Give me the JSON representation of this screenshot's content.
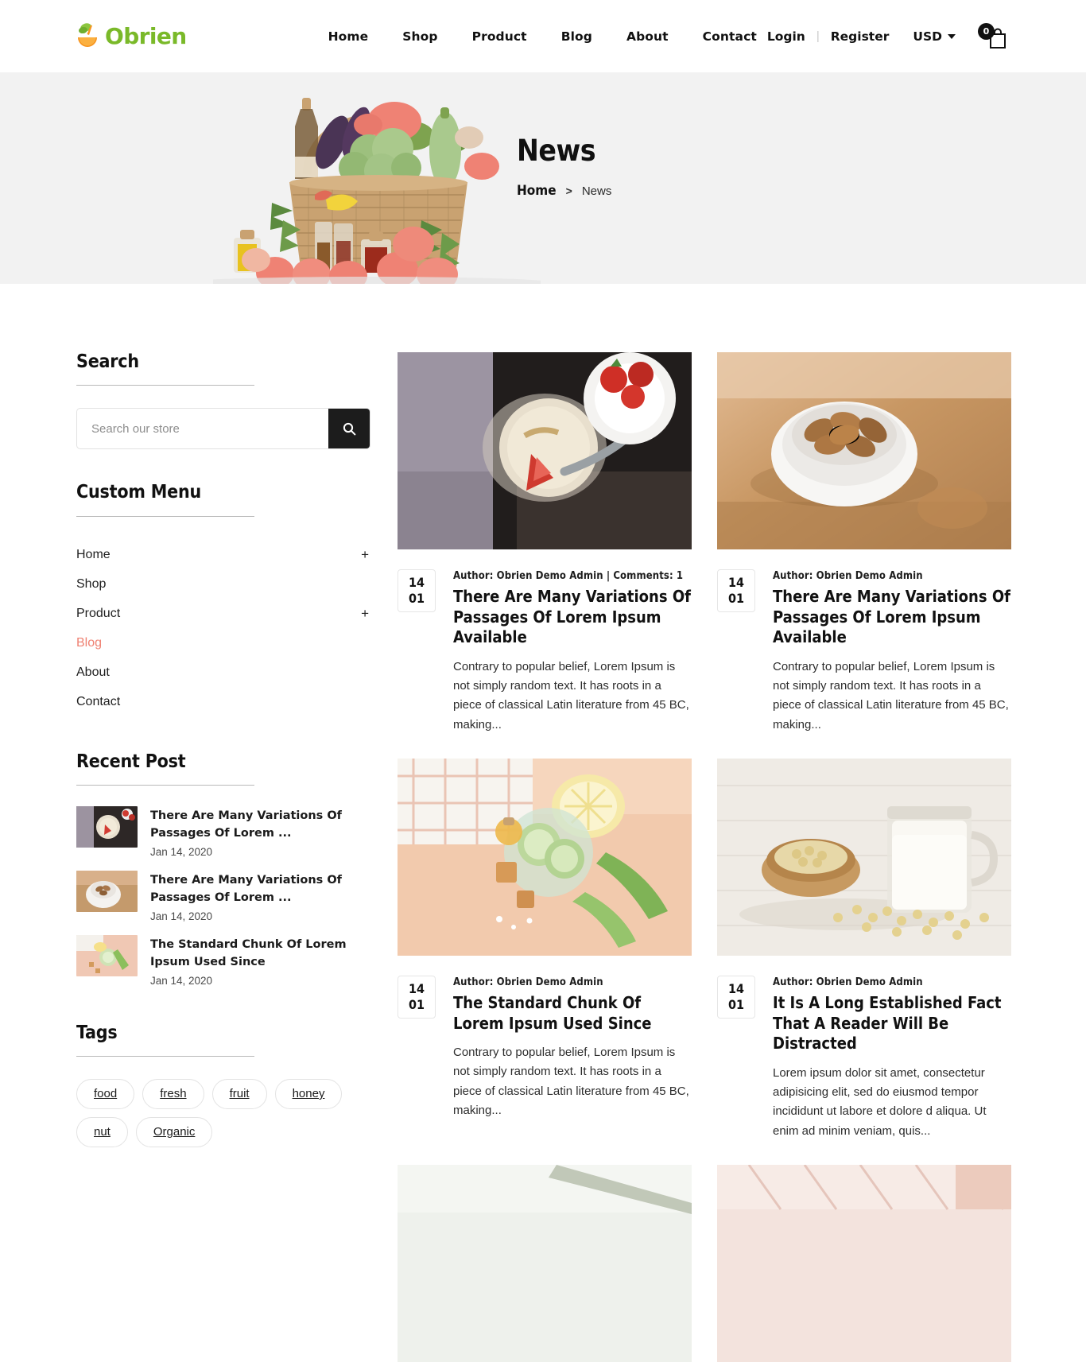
{
  "header": {
    "brand": "Obrien",
    "nav": [
      {
        "label": "Home"
      },
      {
        "label": "Shop"
      },
      {
        "label": "Product"
      },
      {
        "label": "Blog"
      },
      {
        "label": "About"
      },
      {
        "label": "Contact"
      }
    ],
    "login": "Login",
    "separator": "|",
    "register": "Register",
    "currency": "USD",
    "cart_count": "0",
    "brand_color": "#7ab929"
  },
  "hero": {
    "title": "News",
    "breadcrumb_home": "Home",
    "breadcrumb_sep": ">",
    "breadcrumb_current": "News",
    "background": "#f2f2f2"
  },
  "sidebar": {
    "search": {
      "title": "Search",
      "placeholder": "Search our store",
      "value": "",
      "button_icon": "search-icon"
    },
    "custom_menu": {
      "title": "Custom Menu",
      "items": [
        {
          "label": "Home",
          "expand": "+",
          "active": false
        },
        {
          "label": "Shop",
          "expand": "",
          "active": false
        },
        {
          "label": "Product",
          "expand": "+",
          "active": false
        },
        {
          "label": "Blog",
          "expand": "",
          "active": true
        },
        {
          "label": "About",
          "expand": "",
          "active": false
        },
        {
          "label": "Contact",
          "expand": "",
          "active": false
        }
      ],
      "active_color": "#ef8172"
    },
    "recent_post": {
      "title": "Recent Post",
      "items": [
        {
          "title": "There Are Many Variations Of Passages Of Lorem ...",
          "date": "Jan 14, 2020",
          "thumb": "yogurt-strawberry-bowl"
        },
        {
          "title": "There Are Many Variations Of Passages Of Lorem ...",
          "date": "Jan 14, 2020",
          "thumb": "almonds-in-white-bowl"
        },
        {
          "title": "The Standard Chunk Of Lorem Ipsum Used Since",
          "date": "Jan 14, 2020",
          "thumb": "cucumber-aloe-lemon"
        }
      ]
    },
    "tags": {
      "title": "Tags",
      "items": [
        "food",
        "fresh",
        "fruit",
        "honey",
        "nut",
        "Organic"
      ]
    }
  },
  "posts": [
    {
      "image": "yogurt-strawberry-bowl",
      "day": "14",
      "month": "01",
      "meta": "Author: Obrien Demo Admin | Comments: 1",
      "title": "There Are Many Variations Of Passages Of Lorem Ipsum Available",
      "excerpt": "Contrary to popular belief, Lorem Ipsum is not simply random text. It has roots in a piece of classical Latin literature from 45 BC, making..."
    },
    {
      "image": "almonds-in-white-bowl",
      "day": "14",
      "month": "01",
      "meta": "Author: Obrien Demo Admin",
      "title": "There Are Many Variations Of Passages Of Lorem Ipsum Available",
      "excerpt": "Contrary to popular belief, Lorem Ipsum is not simply random text. It has roots in a piece of classical Latin literature from 45 BC, making..."
    },
    {
      "image": "cucumber-aloe-lemon",
      "day": "14",
      "month": "01",
      "meta": "Author: Obrien Demo Admin",
      "title": "The Standard Chunk Of Lorem Ipsum Used Since",
      "excerpt": "Contrary to popular belief, Lorem Ipsum is not simply random text. It has roots in a piece of classical Latin literature from 45 BC, making..."
    },
    {
      "image": "soy-milk-jar-beans",
      "day": "14",
      "month": "01",
      "meta": "Author: Obrien Demo Admin",
      "title": "It Is A Long Established Fact That A Reader Will Be Distracted",
      "excerpt": "Lorem ipsum dolor sit amet, consectetur adipisicing elit, sed do eiusmod tempor incididunt ut labore et dolore d aliqua. Ut enim ad minim veniam, quis..."
    },
    {
      "image": "partial-bottom-left",
      "day": "",
      "month": "",
      "meta": "",
      "title": "",
      "excerpt": ""
    },
    {
      "image": "partial-bottom-right",
      "day": "",
      "month": "",
      "meta": "",
      "title": "",
      "excerpt": ""
    }
  ]
}
